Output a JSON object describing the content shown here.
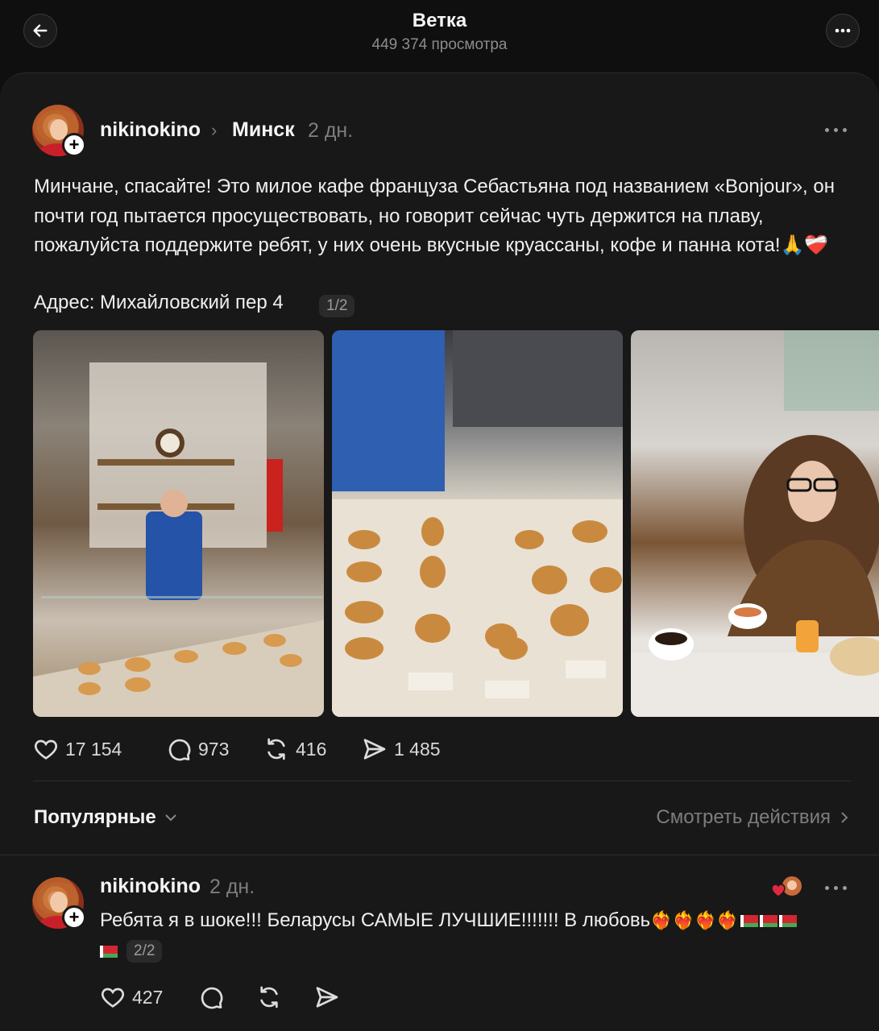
{
  "header": {
    "title": "Ветка",
    "subtitle": "449 374 просмотра"
  },
  "post": {
    "author": "nikinokino",
    "topic": "Минск",
    "time": "2 дн.",
    "text": "Минчане, спасайте! Это милое кафе француза Себастьяна под названием «Bonjour», он почти год пытается просуществовать, но говорит сейчас чуть держится на плаву, пожалуйста поддержите ребят, у них очень вкусные круассаны, кофе и панна кота!🙏❤️‍🩹",
    "address": "Адрес: Михайловский пер 4",
    "counter": "1/2",
    "stats": {
      "likes": "17 154",
      "comments": "973",
      "reposts": "416",
      "shares": "1 485"
    }
  },
  "sort": {
    "label": "Популярные",
    "view_actions": "Смотреть действия"
  },
  "reply": {
    "author": "nikinokino",
    "time": "2 дн.",
    "text": "Ребята я в шоке!!! Беларусы САМЫЕ ЛУЧШИЕ!!!!!!! В любовь",
    "counter": "2/2",
    "stats": {
      "likes": "427"
    }
  }
}
